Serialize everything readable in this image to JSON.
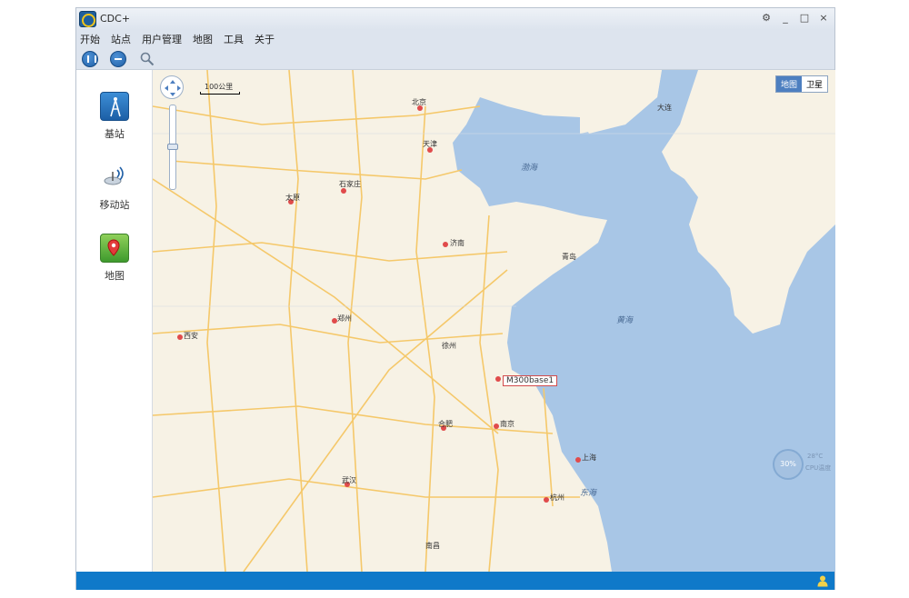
{
  "app": {
    "title": "CDC+",
    "window_buttons": [
      "⚙",
      "_",
      "□",
      "×"
    ]
  },
  "menu": {
    "items": [
      "开始",
      "站点",
      "用户管理",
      "地图",
      "工具",
      "关于"
    ]
  },
  "sidebar": {
    "items": [
      {
        "label": "基站",
        "icon": "base-station-icon"
      },
      {
        "label": "移动站",
        "icon": "mobile-station-icon"
      },
      {
        "label": "地图",
        "icon": "map-pin-icon"
      }
    ]
  },
  "map": {
    "type_toggle": [
      "地图",
      "卫星"
    ],
    "scale": "100公里",
    "marker_label": "M300base1",
    "cpu": {
      "percent": "30%",
      "temperature": "28°C",
      "label": "CPU温度"
    },
    "seas": [
      "渤海",
      "黄海",
      "东海"
    ],
    "cities": [
      "北京",
      "天津",
      "石家庄",
      "济南",
      "郑州",
      "西安",
      "合肥",
      "南京",
      "上海",
      "武汉",
      "杭州",
      "太原",
      "大连",
      "青岛",
      "徐州",
      "南昌"
    ]
  },
  "colors": {
    "statusbar": "#0f79c9",
    "sea": "#a8c6e6",
    "land": "#f7f2e5",
    "road": "#f5c86a",
    "accent": "#1f5fa6"
  }
}
